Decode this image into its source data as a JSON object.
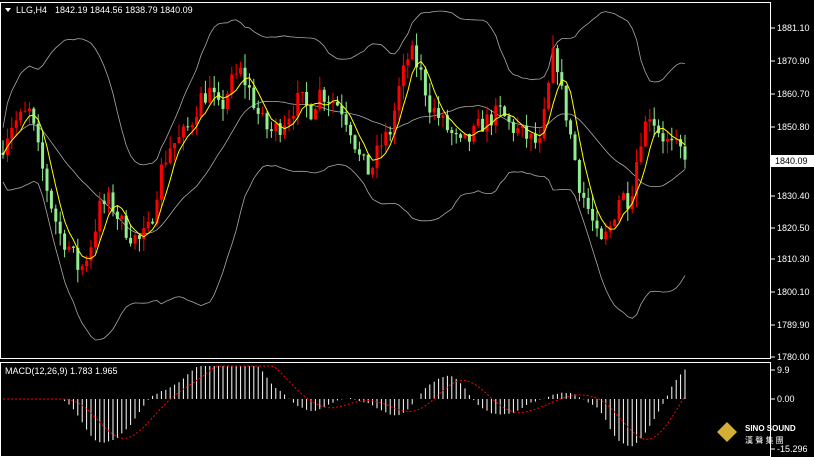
{
  "header": {
    "symbol": "LLG,H4",
    "ohlc": "1842.19 1844.56 1838.79 1840.09"
  },
  "price_axis": {
    "ticks": [
      "1881.10",
      "1870.90",
      "1860.70",
      "1850.80",
      "1840.09",
      "1830.40",
      "1820.50",
      "1810.30",
      "1800.10",
      "1789.90",
      "1780.00"
    ],
    "current_label": "1840.09"
  },
  "macd": {
    "label": "MACD(12,26,9) 1.783 1.965",
    "ticks": [
      "9.9",
      "0.00",
      "-15.296"
    ]
  },
  "logo": {
    "brand": "SINO SOUND",
    "cn": "漢 聲 集 團"
  },
  "colors": {
    "up": "#ff0000",
    "down": "#90ee90",
    "ma": "#ffff00",
    "bands": "#a9a9a9",
    "signal": "#ff0000",
    "hist": "#ffffff",
    "frame": "#ffffff"
  },
  "chart_data": {
    "type": "candlestick",
    "symbol": "LLG",
    "timeframe": "H4",
    "ylim": [
      1780.0,
      1884.0
    ],
    "candles": [],
    "macd": {
      "label": "MACD(12,26,9)",
      "main": 1.783,
      "signal": 1.965,
      "ylim": [
        -15.296,
        9.9
      ]
    }
  }
}
